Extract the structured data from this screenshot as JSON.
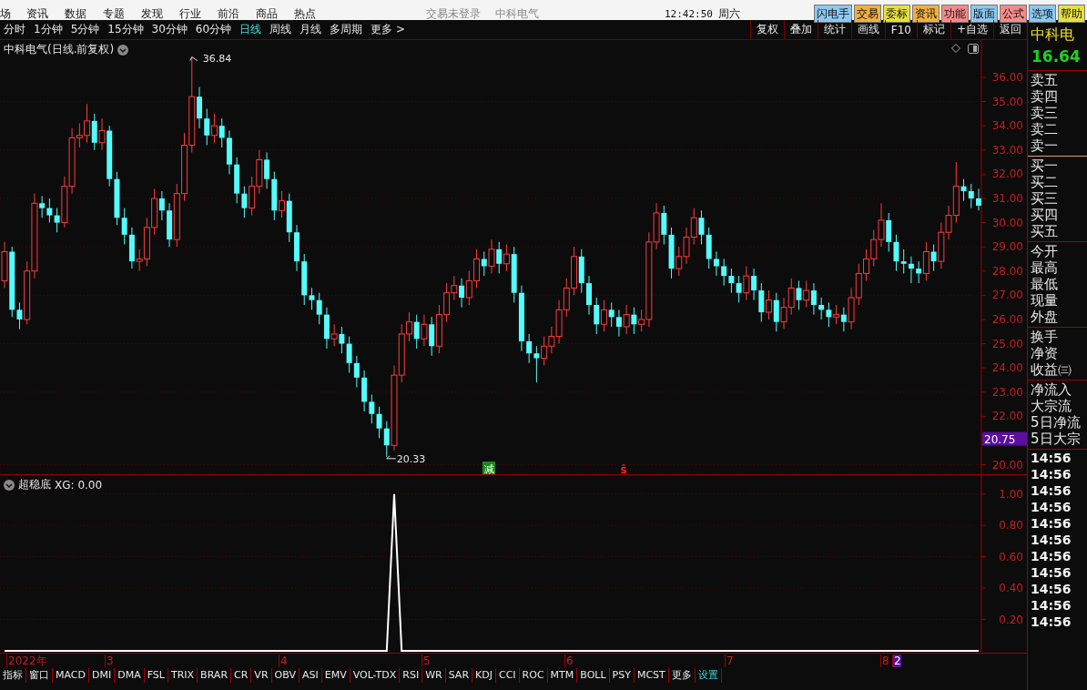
{
  "menu_bar": {
    "items": [
      "场",
      "资讯",
      "数据",
      "专题",
      "发现",
      "行业",
      "前沿",
      "商品",
      "热点"
    ],
    "login_status": "交易未登录",
    "stock_name": "中科电气",
    "clock": "12:42:50",
    "weekday": "周六",
    "buttons": [
      {
        "label": "闪电手",
        "color": "#8cc8f0"
      },
      {
        "label": "交易",
        "color": "#f0b040"
      },
      {
        "label": "委标",
        "color": "#e6e040"
      },
      {
        "label": "资讯",
        "color": "#f0b040"
      },
      {
        "label": "功能",
        "color": "#f58a8a"
      },
      {
        "label": "版面",
        "color": "#8cc8f0"
      },
      {
        "label": "公式",
        "color": "#f58a8a"
      },
      {
        "label": "选项",
        "color": "#8cc8f0"
      },
      {
        "label": "帮助",
        "color": "#e6e040"
      }
    ]
  },
  "period_tabs": [
    {
      "label": "分时",
      "selected": false
    },
    {
      "label": "1分钟",
      "selected": false
    },
    {
      "label": "5分钟",
      "selected": false
    },
    {
      "label": "15分钟",
      "selected": false
    },
    {
      "label": "30分钟",
      "selected": false
    },
    {
      "label": "60分钟",
      "selected": false
    },
    {
      "label": "日线",
      "selected": true
    },
    {
      "label": "周线",
      "selected": false
    },
    {
      "label": "月线",
      "selected": false
    },
    {
      "label": "多周期",
      "selected": false
    },
    {
      "label": "更多 >",
      "selected": false
    }
  ],
  "chart_tools": [
    "复权",
    "叠加",
    "统计",
    "画线",
    "F10",
    "标记",
    "+自选",
    "返回"
  ],
  "main_chart": {
    "title": "中科电气(日线.前复权)",
    "high_label": "36.84",
    "low_label": "20.33",
    "current_price": "20.75",
    "chart_data": {
      "type": "candlestick",
      "grid": true,
      "ylim": [
        19.57,
        37.54
      ],
      "yticks": [
        {
          "value": 36,
          "label": "36.00"
        },
        {
          "value": 35,
          "label": "35.00"
        },
        {
          "value": 34,
          "label": "34.00"
        },
        {
          "value": 33,
          "label": "33.00"
        },
        {
          "value": 32,
          "label": "32.00"
        },
        {
          "value": 31,
          "label": "31.00"
        },
        {
          "value": 30,
          "label": "30.00"
        },
        {
          "value": 29,
          "label": "29.00"
        },
        {
          "value": 28,
          "label": "28.00"
        },
        {
          "value": 27,
          "label": "27.00"
        },
        {
          "value": 26,
          "label": "26.00"
        },
        {
          "value": 25,
          "label": "25.00"
        },
        {
          "value": 24,
          "label": "24.00"
        },
        {
          "value": 23,
          "label": "23.00"
        },
        {
          "value": 22,
          "label": "22.00"
        },
        {
          "value": 20,
          "label": "20.00"
        }
      ],
      "ohlc": [
        [
          27.6,
          29.2,
          27.3,
          28.8
        ],
        [
          28.8,
          29.0,
          26.1,
          26.4
        ],
        [
          26.4,
          26.7,
          25.6,
          26.0
        ],
        [
          26.0,
          28.4,
          25.8,
          28.0
        ],
        [
          28.0,
          31.2,
          27.7,
          30.8
        ],
        [
          30.8,
          31.1,
          30.2,
          30.6
        ],
        [
          30.6,
          31.0,
          30.0,
          30.3
        ],
        [
          30.3,
          30.6,
          29.6,
          30.0
        ],
        [
          30.0,
          31.9,
          29.8,
          31.5
        ],
        [
          31.5,
          33.9,
          31.2,
          33.5
        ],
        [
          33.5,
          34.1,
          33.1,
          33.6
        ],
        [
          33.6,
          34.9,
          33.3,
          34.2
        ],
        [
          34.2,
          34.5,
          33.0,
          33.3
        ],
        [
          33.3,
          34.3,
          33.0,
          33.8
        ],
        [
          33.8,
          34.0,
          31.5,
          31.8
        ],
        [
          31.8,
          32.1,
          29.9,
          30.2
        ],
        [
          30.2,
          30.6,
          29.1,
          29.5
        ],
        [
          29.5,
          29.8,
          28.1,
          28.4
        ],
        [
          28.4,
          28.9,
          28.0,
          28.5
        ],
        [
          28.5,
          30.2,
          28.2,
          29.8
        ],
        [
          29.8,
          31.4,
          29.5,
          31.0
        ],
        [
          31.0,
          31.3,
          30.1,
          30.5
        ],
        [
          30.5,
          30.8,
          29.0,
          29.3
        ],
        [
          29.3,
          31.6,
          29.0,
          31.2
        ],
        [
          31.2,
          33.7,
          30.9,
          33.2
        ],
        [
          33.2,
          36.84,
          32.9,
          35.2
        ],
        [
          35.2,
          35.6,
          33.9,
          34.3
        ],
        [
          34.3,
          34.7,
          33.2,
          33.6
        ],
        [
          33.6,
          34.5,
          33.3,
          34.0
        ],
        [
          34.0,
          34.3,
          33.1,
          33.5
        ],
        [
          33.5,
          33.8,
          32.0,
          32.4
        ],
        [
          32.4,
          32.7,
          30.8,
          31.2
        ],
        [
          31.2,
          31.5,
          30.2,
          30.6
        ],
        [
          30.6,
          31.9,
          30.3,
          31.5
        ],
        [
          31.5,
          33.0,
          31.2,
          32.6
        ],
        [
          32.6,
          32.9,
          31.4,
          31.8
        ],
        [
          31.8,
          32.1,
          30.1,
          30.5
        ],
        [
          30.5,
          31.3,
          30.2,
          30.9
        ],
        [
          30.9,
          31.2,
          29.2,
          29.6
        ],
        [
          29.6,
          29.9,
          28.0,
          28.4
        ],
        [
          28.4,
          28.7,
          26.6,
          27.0
        ],
        [
          27.0,
          27.3,
          26.4,
          26.8
        ],
        [
          26.8,
          27.1,
          25.8,
          26.2
        ],
        [
          26.2,
          26.5,
          24.8,
          25.2
        ],
        [
          25.2,
          25.8,
          24.9,
          25.4
        ],
        [
          25.4,
          25.7,
          24.6,
          25.0
        ],
        [
          25.0,
          25.3,
          23.8,
          24.2
        ],
        [
          24.2,
          24.5,
          23.2,
          23.6
        ],
        [
          23.6,
          23.9,
          22.2,
          22.6
        ],
        [
          22.6,
          22.9,
          21.7,
          22.1
        ],
        [
          22.1,
          22.4,
          21.1,
          21.5
        ],
        [
          21.5,
          21.8,
          20.33,
          20.8
        ],
        [
          20.8,
          24.1,
          20.6,
          23.7
        ],
        [
          23.7,
          25.8,
          23.4,
          25.4
        ],
        [
          25.4,
          26.3,
          25.1,
          25.9
        ],
        [
          25.9,
          26.2,
          24.8,
          25.2
        ],
        [
          25.2,
          26.2,
          24.9,
          25.8
        ],
        [
          25.8,
          26.1,
          24.5,
          24.9
        ],
        [
          24.9,
          26.6,
          24.6,
          26.2
        ],
        [
          26.2,
          27.5,
          25.9,
          27.1
        ],
        [
          27.1,
          27.8,
          26.8,
          27.4
        ],
        [
          27.4,
          27.7,
          26.5,
          26.9
        ],
        [
          26.9,
          28.0,
          26.6,
          27.6
        ],
        [
          27.6,
          28.9,
          27.3,
          28.5
        ],
        [
          28.5,
          28.8,
          27.8,
          28.2
        ],
        [
          28.2,
          29.3,
          27.9,
          28.9
        ],
        [
          28.9,
          29.2,
          27.9,
          28.3
        ],
        [
          28.3,
          29.1,
          28.0,
          28.7
        ],
        [
          28.7,
          29.0,
          26.7,
          27.1
        ],
        [
          27.1,
          27.4,
          24.7,
          25.1
        ],
        [
          25.1,
          25.4,
          24.2,
          24.6
        ],
        [
          24.6,
          24.9,
          23.4,
          24.4
        ],
        [
          24.4,
          25.3,
          24.1,
          24.9
        ],
        [
          24.9,
          25.7,
          24.6,
          25.3
        ],
        [
          25.3,
          26.8,
          25.0,
          26.4
        ],
        [
          26.4,
          27.7,
          26.1,
          27.3
        ],
        [
          27.3,
          29.0,
          27.0,
          28.6
        ],
        [
          28.6,
          28.9,
          27.1,
          27.5
        ],
        [
          27.5,
          27.8,
          26.2,
          26.6
        ],
        [
          26.6,
          26.9,
          25.4,
          25.8
        ],
        [
          25.8,
          26.8,
          25.5,
          26.4
        ],
        [
          26.4,
          26.7,
          25.7,
          26.1
        ],
        [
          26.1,
          26.4,
          25.3,
          25.7
        ],
        [
          25.7,
          26.6,
          25.4,
          26.2
        ],
        [
          26.2,
          26.5,
          25.4,
          25.8
        ],
        [
          25.8,
          26.4,
          25.5,
          26.0
        ],
        [
          26.0,
          29.6,
          25.7,
          29.2
        ],
        [
          29.2,
          30.8,
          28.9,
          30.4
        ],
        [
          30.4,
          30.7,
          29.1,
          29.5
        ],
        [
          29.5,
          29.8,
          27.7,
          28.1
        ],
        [
          28.1,
          29.0,
          27.8,
          28.6
        ],
        [
          28.6,
          29.8,
          28.3,
          29.4
        ],
        [
          29.4,
          30.6,
          29.1,
          30.2
        ],
        [
          30.2,
          30.5,
          29.1,
          29.5
        ],
        [
          29.5,
          29.8,
          28.1,
          28.5
        ],
        [
          28.5,
          28.8,
          27.8,
          28.2
        ],
        [
          28.2,
          28.5,
          27.4,
          27.8
        ],
        [
          27.8,
          28.1,
          27.1,
          27.5
        ],
        [
          27.5,
          27.8,
          26.7,
          27.1
        ],
        [
          27.1,
          28.2,
          26.8,
          27.8
        ],
        [
          27.8,
          28.1,
          26.8,
          27.2
        ],
        [
          27.2,
          27.5,
          25.9,
          26.3
        ],
        [
          26.3,
          27.2,
          26.0,
          26.8
        ],
        [
          26.8,
          27.1,
          25.5,
          25.9
        ],
        [
          25.9,
          26.9,
          25.6,
          26.5
        ],
        [
          26.5,
          27.7,
          26.2,
          27.3
        ],
        [
          27.3,
          27.6,
          26.4,
          26.8
        ],
        [
          26.8,
          27.6,
          26.5,
          27.2
        ],
        [
          27.2,
          27.5,
          26.2,
          26.6
        ],
        [
          26.6,
          26.9,
          26.0,
          26.4
        ],
        [
          26.4,
          26.7,
          25.7,
          26.1
        ],
        [
          26.1,
          26.6,
          25.8,
          26.2
        ],
        [
          26.2,
          26.5,
          25.5,
          25.9
        ],
        [
          25.9,
          27.3,
          25.6,
          26.9
        ],
        [
          26.9,
          28.3,
          26.6,
          27.9
        ],
        [
          27.9,
          28.9,
          27.6,
          28.5
        ],
        [
          28.5,
          29.7,
          28.2,
          29.3
        ],
        [
          29.3,
          30.8,
          29.0,
          30.1
        ],
        [
          30.1,
          30.4,
          28.8,
          29.2
        ],
        [
          29.2,
          29.5,
          28.0,
          28.4
        ],
        [
          28.4,
          28.9,
          27.9,
          28.3
        ],
        [
          28.3,
          28.6,
          27.5,
          28.1
        ],
        [
          28.1,
          28.4,
          27.5,
          27.9
        ],
        [
          27.9,
          29.2,
          27.6,
          28.8
        ],
        [
          28.8,
          29.1,
          28.0,
          28.4
        ],
        [
          28.4,
          30.0,
          28.1,
          29.6
        ],
        [
          29.6,
          30.7,
          29.3,
          30.3
        ],
        [
          30.3,
          32.5,
          30.0,
          31.5
        ],
        [
          31.5,
          31.8,
          30.9,
          31.3
        ],
        [
          31.3,
          31.6,
          30.6,
          31.0
        ],
        [
          31.0,
          31.4,
          30.5,
          30.7
        ]
      ]
    },
    "signals": [
      {
        "label": "减",
        "kind": "box",
        "color": "#1a8a1a"
      },
      {
        "label": "ŝ",
        "kind": "plain",
        "color": "#ff2020"
      }
    ]
  },
  "indicator": {
    "title": "超稳底",
    "reading": "XG: 0.00",
    "chart_data": {
      "type": "line",
      "grid": true,
      "ylim": [
        0,
        1.12
      ],
      "yticks": [
        {
          "value": 1,
          "label": "1.00"
        },
        {
          "value": 0.8,
          "label": "0.80"
        },
        {
          "value": 0.6,
          "label": "0.60"
        },
        {
          "value": 0.4,
          "label": "0.40"
        },
        {
          "value": 0.2,
          "label": "0.20"
        }
      ],
      "series": [
        {
          "color": "#ffffff",
          "values": [
            0,
            0,
            0,
            0,
            0,
            0,
            0,
            0,
            0,
            0,
            0,
            0,
            0,
            0,
            0,
            0,
            0,
            0,
            0,
            0,
            0,
            0,
            0,
            0,
            0,
            0,
            0,
            0,
            0,
            0,
            0,
            0,
            0,
            0,
            0,
            0,
            0,
            0,
            0,
            0,
            0,
            0,
            0,
            0,
            0,
            0,
            0,
            0,
            0,
            0,
            0,
            0,
            1,
            0,
            0,
            0,
            0,
            0,
            0,
            0,
            0,
            0,
            0,
            0,
            0,
            0,
            0,
            0,
            0,
            0,
            0,
            0,
            0,
            0,
            0,
            0,
            0,
            0,
            0,
            0,
            0,
            0,
            0,
            0,
            0,
            0,
            0,
            0,
            0,
            0,
            0,
            0,
            0,
            0,
            0,
            0,
            0,
            0,
            0,
            0,
            0,
            0,
            0,
            0,
            0,
            0,
            0,
            0,
            0,
            0,
            0,
            0,
            0,
            0,
            0,
            0,
            0,
            0,
            0,
            0,
            0,
            0,
            0,
            0,
            0,
            0,
            0,
            0,
            0,
            0,
            0
          ]
        }
      ]
    }
  },
  "date_axis": [
    {
      "label": "2022年",
      "kind": "tick"
    },
    {
      "label": "3",
      "kind": "tick"
    },
    {
      "label": "4",
      "kind": "tick"
    },
    {
      "label": "5",
      "kind": "tick"
    },
    {
      "label": "6",
      "kind": "tick"
    },
    {
      "label": "7",
      "kind": "tick"
    },
    {
      "label": "8",
      "kind": "tick"
    },
    {
      "label": "2",
      "kind": "cursor"
    }
  ],
  "indicator_tabs": [
    {
      "label": "指标",
      "kind": "tab"
    },
    {
      "label": "窗口",
      "kind": "tab"
    },
    {
      "label": "MACD",
      "kind": "tab"
    },
    {
      "label": "DMI",
      "kind": "tab"
    },
    {
      "label": "DMA",
      "kind": "tab"
    },
    {
      "label": "FSL",
      "kind": "tab"
    },
    {
      "label": "TRIX",
      "kind": "tab"
    },
    {
      "label": "BRAR",
      "kind": "tab"
    },
    {
      "label": "CR",
      "kind": "tab"
    },
    {
      "label": "VR",
      "kind": "tab"
    },
    {
      "label": "OBV",
      "kind": "tab"
    },
    {
      "label": "ASI",
      "kind": "tab"
    },
    {
      "label": "EMV",
      "kind": "tab"
    },
    {
      "label": "VOL-TDX",
      "kind": "tab"
    },
    {
      "label": "RSI",
      "kind": "tab"
    },
    {
      "label": "WR",
      "kind": "tab"
    },
    {
      "label": "SAR",
      "kind": "tab"
    },
    {
      "label": "KDJ",
      "kind": "tab"
    },
    {
      "label": "CCI",
      "kind": "tab"
    },
    {
      "label": "ROC",
      "kind": "tab"
    },
    {
      "label": "MTM",
      "kind": "tab"
    },
    {
      "label": "BOLL",
      "kind": "tab"
    },
    {
      "label": "PSY",
      "kind": "tab"
    },
    {
      "label": "MCST",
      "kind": "tab"
    },
    {
      "label": "更多",
      "kind": "tab"
    },
    {
      "label": "设置",
      "kind": "settings"
    }
  ],
  "quote_panel": {
    "name": "中科电",
    "price": "16.64",
    "groups": [
      [
        "卖五",
        "卖四",
        "卖三",
        "卖二",
        "卖一"
      ],
      [
        "买一",
        "买二",
        "买三",
        "买四",
        "买五"
      ],
      [
        "今开",
        "最高",
        "最低",
        "现量",
        "外盘"
      ],
      [
        "换手",
        "净资",
        "收益㈢"
      ],
      [
        "净流入",
        "大宗流",
        "5日净流",
        "5日大宗"
      ]
    ],
    "trade_times": [
      "14:56",
      "14:56",
      "14:56",
      "14:56",
      "14:56",
      "14:56",
      "14:56",
      "14:56",
      "14:56",
      "14:56",
      "14:56"
    ]
  }
}
